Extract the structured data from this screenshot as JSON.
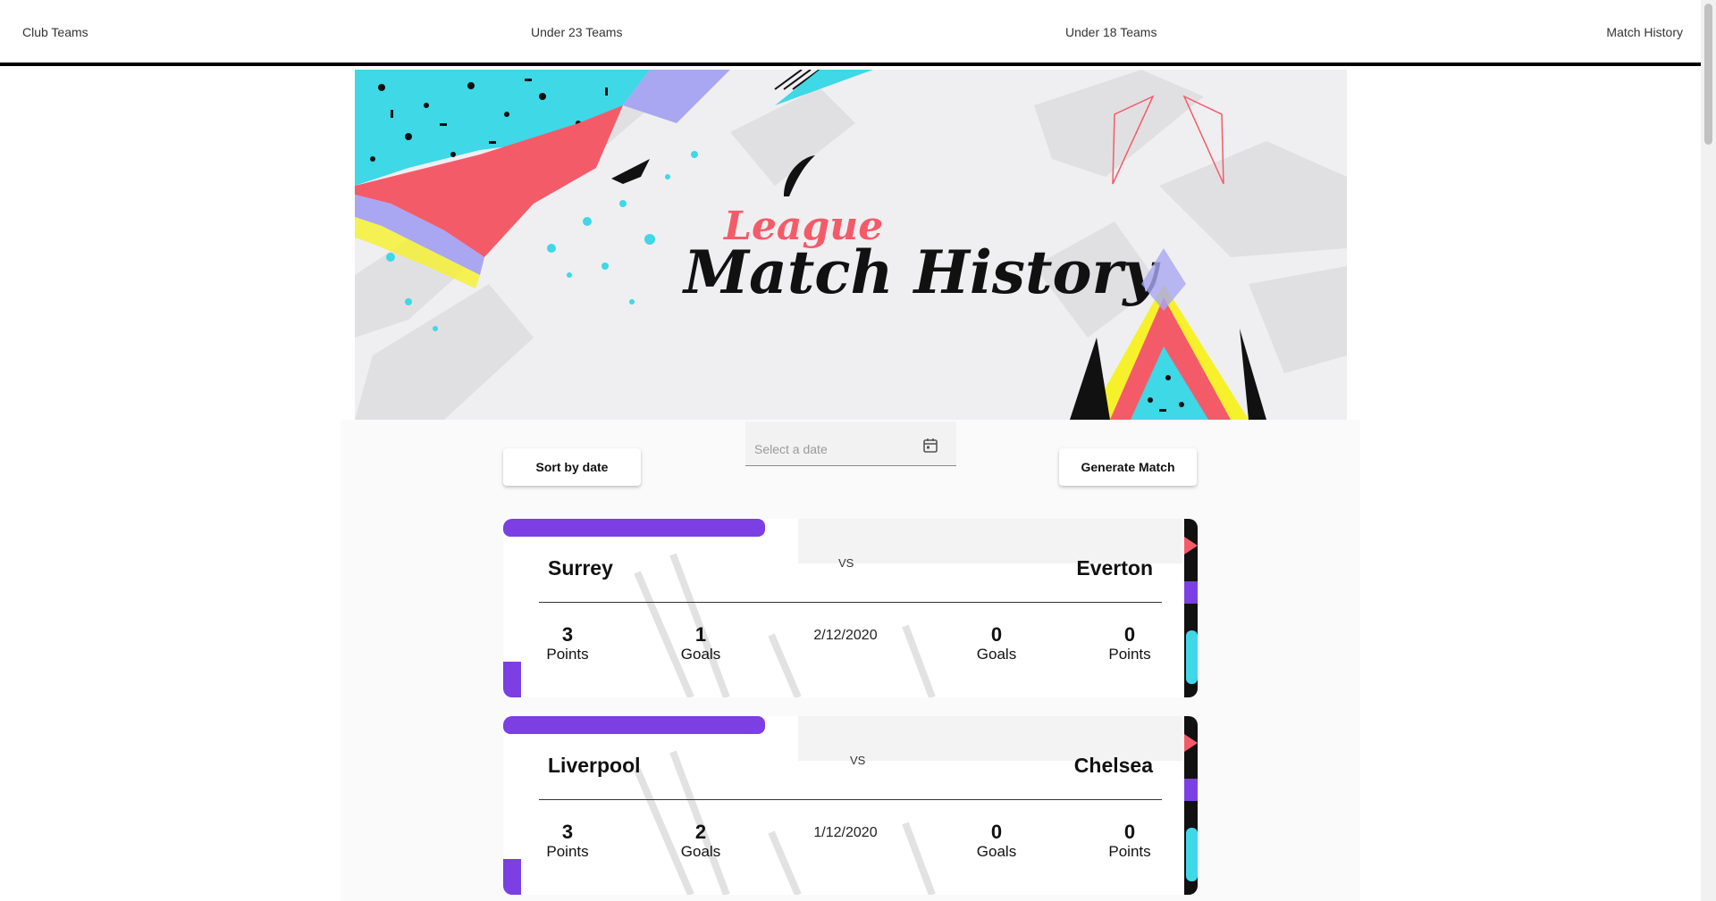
{
  "nav": {
    "links": [
      "Club Teams",
      "Under 23 Teams",
      "Under 18 Teams",
      "Match History"
    ]
  },
  "banner": {
    "subtitle": "League",
    "title": "Match History"
  },
  "controls": {
    "sort_label": "Sort by date",
    "date_placeholder": "Select a date",
    "generate_label": "Generate Match"
  },
  "matches": [
    {
      "home_team": "Surrey",
      "away_team": "Everton",
      "vs": "VS",
      "home_points": "3",
      "home_goals": "1",
      "date": "2/12/2020",
      "away_goals": "0",
      "away_points": "0",
      "points_label": "Points",
      "goals_label": "Goals"
    },
    {
      "home_team": "Liverpool",
      "away_team": "Chelsea",
      "vs": "VS",
      "home_points": "3",
      "home_goals": "2",
      "date": "1/12/2020",
      "away_goals": "0",
      "away_points": "0",
      "points_label": "Points",
      "goals_label": "Goals"
    }
  ],
  "colors": {
    "accent_purple": "#7b3fe4",
    "coral": "#f45b69",
    "cyan": "#3ed8e6",
    "yellow": "#f6f12b",
    "lavender": "#a9a7f2"
  },
  "icons": {
    "calendar": "calendar-icon"
  }
}
